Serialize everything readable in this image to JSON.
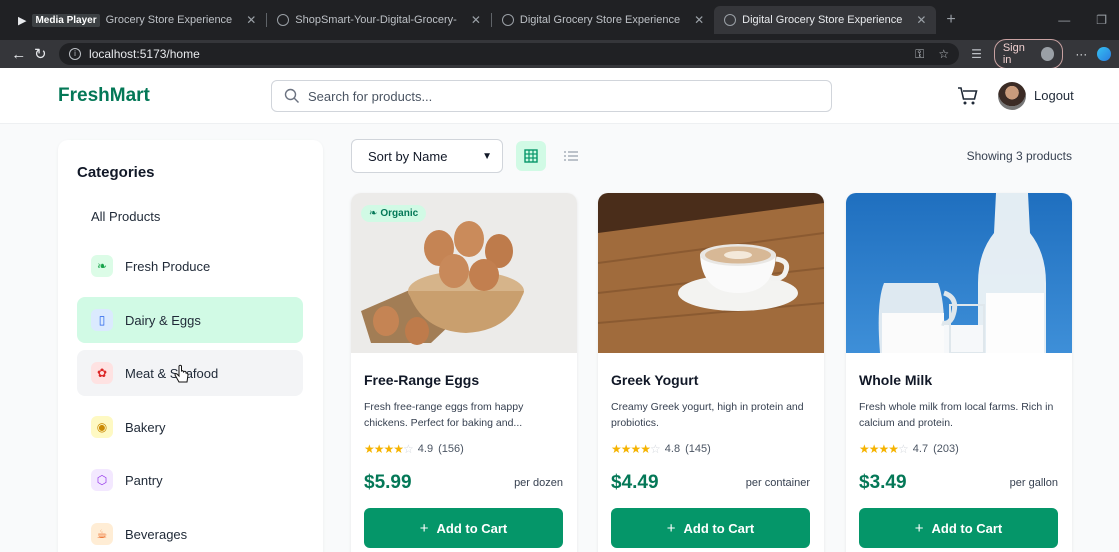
{
  "browser": {
    "tabs": [
      {
        "label": "Grocery Store Experience",
        "prefix": "Media Player"
      },
      {
        "label": "ShopSmart-Your-Digital-Grocery-"
      },
      {
        "label": "Digital Grocery Store Experience"
      },
      {
        "label": "Digital Grocery Store Experience"
      }
    ],
    "url": "localhost:5173/home",
    "signin_label": "Sign in"
  },
  "header": {
    "logo": "FreshMart",
    "search_placeholder": "Search for products...",
    "logout_label": "Logout"
  },
  "sidebar": {
    "title": "Categories",
    "all_label": "All Products",
    "items": [
      {
        "label": "Fresh Produce",
        "icon": "leaf-icon",
        "color": "#dcfce7"
      },
      {
        "label": "Dairy & Eggs",
        "icon": "milk-bottle-icon",
        "color": "#dbeafe"
      },
      {
        "label": "Meat & Seafood",
        "icon": "fish-icon",
        "color": "#fee2e2"
      },
      {
        "label": "Bakery",
        "icon": "cookie-icon",
        "color": "#fef9c3"
      },
      {
        "label": "Pantry",
        "icon": "package-icon",
        "color": "#f3e8ff"
      },
      {
        "label": "Beverages",
        "icon": "coffee-icon",
        "color": "#ffedd5"
      }
    ],
    "active": "Dairy & Eggs"
  },
  "toolbar": {
    "sort_label": "Sort by Name",
    "showing_text": "Showing 3 products"
  },
  "products": [
    {
      "name": "Free-Range Eggs",
      "desc": "Fresh free-range eggs from happy chickens. Perfect for baking and...",
      "rating": "4.9",
      "reviews": "(156)",
      "price": "$5.99",
      "unit": "per dozen",
      "badge": "Organic",
      "stars": 4
    },
    {
      "name": "Greek Yogurt",
      "desc": "Creamy Greek yogurt, high in protein and probiotics.",
      "rating": "4.8",
      "reviews": "(145)",
      "price": "$4.49",
      "unit": "per container",
      "stars": 4
    },
    {
      "name": "Whole Milk",
      "desc": "Fresh whole milk from local farms. Rich in calcium and protein.",
      "rating": "4.7",
      "reviews": "(203)",
      "price": "$3.49",
      "unit": "per gallon",
      "stars": 4
    }
  ],
  "add_to_cart_label": "Add to Cart",
  "colors": {
    "brand": "#047857",
    "button": "#059669",
    "active_bg": "#d1fae5"
  }
}
